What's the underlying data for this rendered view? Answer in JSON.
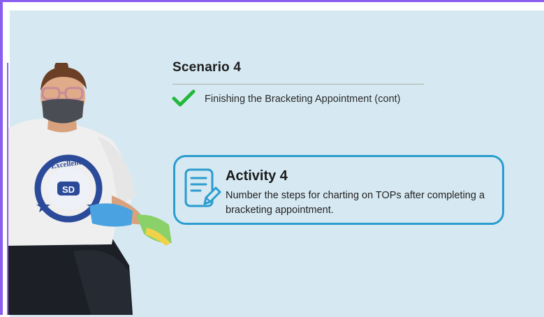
{
  "slide": {
    "title": "Scenario 4",
    "subtitle": "Finishing the Bracketing Appointment (cont)",
    "activity": {
      "title": "Activity 4",
      "description": "Number the steps for charting on TOPs after completing a bracketing appointment."
    },
    "photo": {
      "shirt_text": "Excellence",
      "shirt_logo": "SD"
    },
    "colors": {
      "background": "#d6e9f2",
      "accent": "#2a9ccf",
      "check": "#22b83a",
      "frame": "#8a5cf0"
    }
  }
}
